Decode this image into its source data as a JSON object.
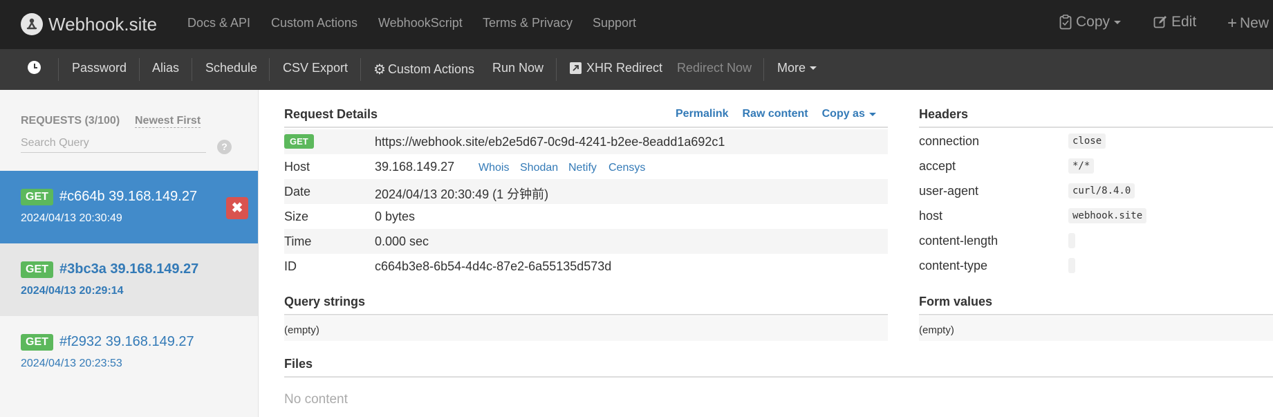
{
  "brand": {
    "name": "Webhook.site"
  },
  "topnav": {
    "items": [
      "Docs & API",
      "Custom Actions",
      "WebhookScript",
      "Terms & Privacy",
      "Support"
    ],
    "copy_label": "Copy",
    "edit_label": "Edit",
    "new_label": "New"
  },
  "toolbar": {
    "password": "Password",
    "alias": "Alias",
    "schedule": "Schedule",
    "csv_export": "CSV Export",
    "custom_actions": "Custom Actions",
    "run_now": "Run Now",
    "xhr_redirect": "XHR Redirect",
    "redirect_now": "Redirect Now",
    "more": "More"
  },
  "sidebar": {
    "requests_count": "REQUESTS (3/100)",
    "sort_label": "Newest First",
    "search_placeholder": "Search Query",
    "help_symbol": "?",
    "requests": [
      {
        "method": "GET",
        "title": "#c664b 39.168.149.27",
        "date": "2024/04/13 20:30:49"
      },
      {
        "method": "GET",
        "title": "#3bc3a 39.168.149.27",
        "date": "2024/04/13 20:29:14"
      },
      {
        "method": "GET",
        "title": "#f2932 39.168.149.27",
        "date": "2024/04/13 20:23:53"
      }
    ]
  },
  "details": {
    "title": "Request Details",
    "permalink": "Permalink",
    "raw_content": "Raw content",
    "copy_as": "Copy as",
    "method": "GET",
    "url": "https://webhook.site/eb2e5d67-0c9d-4241-b2ee-8eadd1a692c1",
    "host_label": "Host",
    "host_value": "39.168.149.27",
    "host_links": [
      "Whois",
      "Shodan",
      "Netify",
      "Censys"
    ],
    "date_label": "Date",
    "date_value": "2024/04/13 20:30:49 (1 分钟前)",
    "size_label": "Size",
    "size_value": "0 bytes",
    "time_label": "Time",
    "time_value": "0.000 sec",
    "id_label": "ID",
    "id_value": "c664b3e8-6b54-4d4c-87e2-6a55135d573d"
  },
  "headers": {
    "title": "Headers",
    "rows": [
      {
        "name": "connection",
        "value": "close"
      },
      {
        "name": "accept",
        "value": "*/*"
      },
      {
        "name": "user-agent",
        "value": "curl/8.4.0"
      },
      {
        "name": "host",
        "value": "webhook.site"
      },
      {
        "name": "content-length",
        "value": ""
      },
      {
        "name": "content-type",
        "value": ""
      }
    ]
  },
  "query_strings": {
    "title": "Query strings",
    "empty": "(empty)"
  },
  "form_values": {
    "title": "Form values",
    "empty": "(empty)"
  },
  "files": {
    "title": "Files",
    "empty": "No content"
  },
  "colors": {
    "navbar": "#222222",
    "toolbar": "#3a3a3a",
    "accent": "#428bca",
    "link": "#337ab7",
    "get_badge": "#5cb85c",
    "delete": "#d9534f"
  }
}
